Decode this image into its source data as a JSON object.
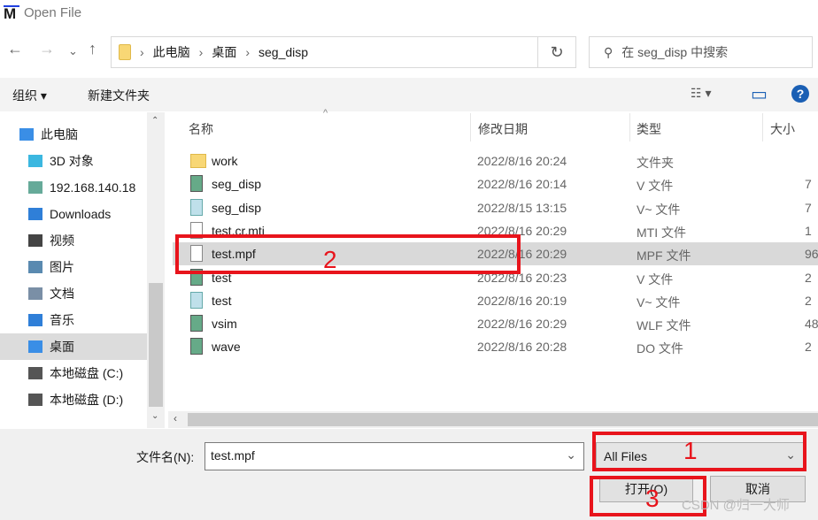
{
  "window": {
    "title": "Open File",
    "logo": "M"
  },
  "nav": {
    "back": "←",
    "forward": "→",
    "recent": "⌄",
    "up": "↑",
    "refresh": "↻",
    "breadcrumb": [
      "此电脑",
      "桌面",
      "seg_disp"
    ],
    "search_placeholder": "在 seg_disp 中搜索"
  },
  "toolbar": {
    "organize": "组织 ▾",
    "new_folder": "新建文件夹",
    "view": "☷ ▾",
    "preview": "▭",
    "help": "?"
  },
  "sidebar": {
    "items": [
      {
        "label": "此电脑",
        "icon": "computer-icon"
      },
      {
        "label": "3D 对象",
        "icon": "cube-icon"
      },
      {
        "label": "192.168.140.18",
        "icon": "network-drive-icon"
      },
      {
        "label": "Downloads",
        "icon": "download-icon"
      },
      {
        "label": "视频",
        "icon": "video-icon"
      },
      {
        "label": "图片",
        "icon": "picture-icon"
      },
      {
        "label": "文档",
        "icon": "document-icon"
      },
      {
        "label": "音乐",
        "icon": "music-icon"
      },
      {
        "label": "桌面",
        "icon": "desktop-icon",
        "selected": true
      },
      {
        "label": "本地磁盘 (C:)",
        "icon": "drive-icon"
      },
      {
        "label": "本地磁盘 (D:)",
        "icon": "drive-icon"
      }
    ]
  },
  "columns": {
    "name": "名称",
    "date": "修改日期",
    "type": "类型",
    "size": "大小"
  },
  "files": [
    {
      "name": "work",
      "date": "2022/8/16 20:24",
      "type": "文件夹",
      "size": "",
      "icon": "folder"
    },
    {
      "name": "seg_disp",
      "date": "2022/8/16 20:14",
      "type": "V 文件",
      "size": "7",
      "icon": "v"
    },
    {
      "name": "seg_disp",
      "date": "2022/8/15 13:15",
      "type": "V~ 文件",
      "size": "7",
      "icon": "bak"
    },
    {
      "name": "test.cr.mti",
      "date": "2022/8/16 20:29",
      "type": "MTI 文件",
      "size": "1",
      "icon": "file"
    },
    {
      "name": "test.mpf",
      "date": "2022/8/16 20:29",
      "type": "MPF 文件",
      "size": "96",
      "icon": "file",
      "selected": true
    },
    {
      "name": "test",
      "date": "2022/8/16 20:23",
      "type": "V 文件",
      "size": "2",
      "icon": "v"
    },
    {
      "name": "test",
      "date": "2022/8/16 20:19",
      "type": "V~ 文件",
      "size": "2",
      "icon": "bak"
    },
    {
      "name": "vsim",
      "date": "2022/8/16 20:29",
      "type": "WLF 文件",
      "size": "48",
      "icon": "v"
    },
    {
      "name": "wave",
      "date": "2022/8/16 20:28",
      "type": "DO 文件",
      "size": "2",
      "icon": "v"
    }
  ],
  "bottom": {
    "filename_label": "文件名(N):",
    "filename_value": "test.mpf",
    "filter": "All Files",
    "open": "打开(O)",
    "cancel": "取消"
  },
  "annotations": [
    "1",
    "2",
    "3"
  ],
  "watermark": "CSDN @归一大师",
  "colors": {
    "annotation": "#e8141c",
    "selection": "#d9d9d9"
  }
}
